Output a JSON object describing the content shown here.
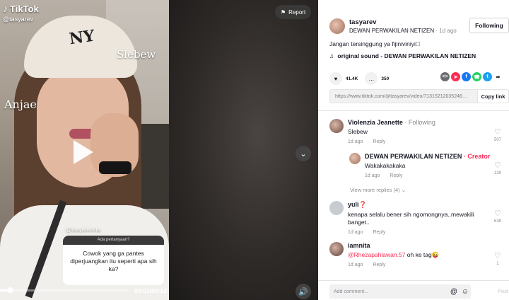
{
  "video": {
    "logo_text": "TikTok",
    "handle": "@tasyarev",
    "overlay_slebew": "Slebew",
    "overlay_anjae": "Anjae",
    "overlay_handle": "@tasyarevina",
    "question_header": "Ada pertanyaan?",
    "question_text": "Cowok yang ga pantes diperjuangkan itu seperti apa sih ka?",
    "time": "00:01/00:13",
    "progress_fraction": 0.08,
    "report_label": "Report"
  },
  "author": {
    "username": "tasyarev",
    "display_name": "DEWAN PERWAKILAN NETIZEN",
    "age": " · 1d ago",
    "follow_label": "Following"
  },
  "post": {
    "caption": "Jangan tersinggung ya fijiniviniyi⃣",
    "sound": "original sound - DEWAN PERWAKILAN NETIZEN",
    "likes": "41.4K",
    "comments": "350",
    "link": "https://www.tiktok.com/@tasyarev/video/71315212035246…",
    "copy_label": "Copy link"
  },
  "share_icons": [
    {
      "name": "embed-icon",
      "color": "#6b6b70",
      "glyph": "<>"
    },
    {
      "name": "send-icon",
      "color": "#fe2c55",
      "glyph": "➤"
    },
    {
      "name": "facebook-icon",
      "color": "#1877f2",
      "glyph": "f"
    },
    {
      "name": "whatsapp-icon",
      "color": "#25d366",
      "glyph": "☎"
    },
    {
      "name": "twitter-icon",
      "color": "#1da1f2",
      "glyph": "t"
    },
    {
      "name": "share-arrow-icon",
      "color": "#ffffff",
      "glyph": "➦"
    }
  ],
  "comments": [
    {
      "name": "Violenzia Jeanette",
      "tag": " · Following",
      "text": "Slebew",
      "age": "1d ago",
      "reply": "Reply",
      "likes": "507"
    },
    {
      "name": "DEWAN PERWAKILAN NETIZEN",
      "tag": " · Creator",
      "text": "Wakakakakaka",
      "age": "1d ago",
      "reply": "Reply",
      "likes": "139"
    },
    {
      "name": "yuli❓",
      "text": "kenapa selalu bener sih ngomongnya..mewakili banget..",
      "age": "1d ago",
      "reply": "Reply",
      "likes": "638"
    },
    {
      "name": "iamnita",
      "mention": "@Rhezapahlawan.57",
      "text": " oh ke tag😜",
      "age": "1d ago",
      "reply": "Reply",
      "likes": "1"
    }
  ],
  "view_more": "View more replies (4) ⌄",
  "comment_bar": {
    "placeholder": "Add comment...",
    "post_label": "Post"
  }
}
